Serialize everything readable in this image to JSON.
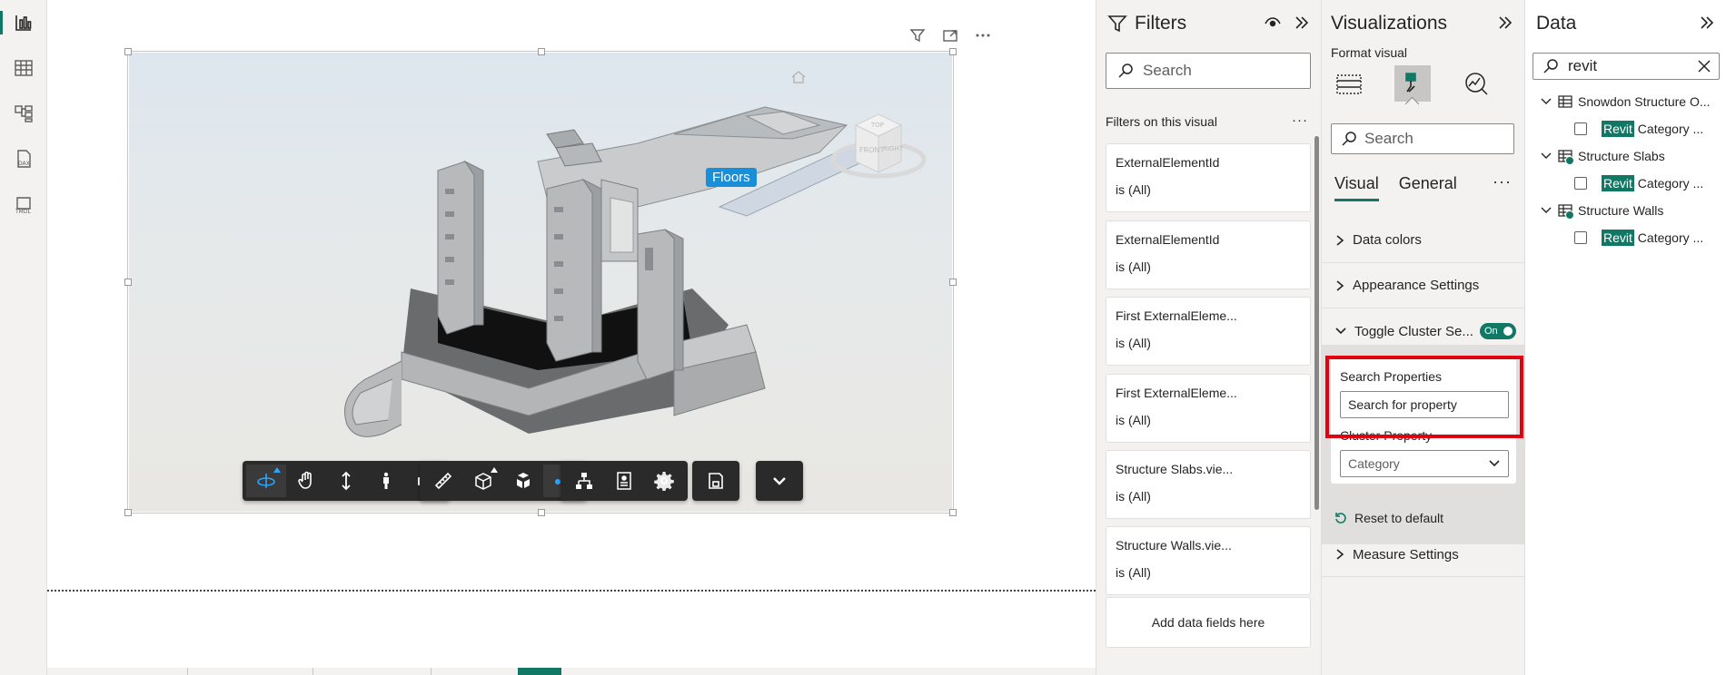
{
  "rail": {
    "items": [
      {
        "name": "report-view",
        "icon": "bar-chart-icon"
      },
      {
        "name": "table-view",
        "icon": "table-icon"
      },
      {
        "name": "model-view",
        "icon": "model-icon"
      },
      {
        "name": "dax-view",
        "icon": "dax-icon",
        "label": "DAX"
      },
      {
        "name": "tmdl-view",
        "icon": "tmdl-icon",
        "label": "TMDL"
      }
    ]
  },
  "visual": {
    "label": "Floors"
  },
  "filters": {
    "title": "Filters",
    "search_placeholder": "Search",
    "section_title": "Filters on this visual",
    "cards": [
      {
        "name": "ExternalElementId",
        "value": "is (All)"
      },
      {
        "name": "ExternalElementId",
        "value": "is (All)"
      },
      {
        "name": "First ExternalEleme...",
        "value": "is (All)"
      },
      {
        "name": "First ExternalEleme...",
        "value": "is (All)"
      },
      {
        "name": "Structure Slabs.vie...",
        "value": "is (All)"
      },
      {
        "name": "Structure Walls.vie...",
        "value": "is (All)"
      }
    ],
    "add_fields": "Add data fields here"
  },
  "viz": {
    "title": "Visualizations",
    "format_label": "Format visual",
    "search_placeholder": "Search",
    "tabs": [
      "Visual",
      "General"
    ],
    "sections": {
      "data_colors": "Data colors",
      "appearance": "Appearance Settings",
      "toggle_cluster": "Toggle Cluster Se...",
      "toggle_state": "On",
      "measure": "Measure Settings"
    },
    "cluster": {
      "search_label": "Search Properties",
      "search_placeholder": "Search for property",
      "cluster_label": "Cluster Property",
      "cluster_value": "Category"
    },
    "reset": "Reset to default"
  },
  "data": {
    "title": "Data",
    "search_value": "revit",
    "tables": [
      {
        "name": "Snowdon Structure O...",
        "child_hl": "Revit",
        "child_rest": " Category ..."
      },
      {
        "name": "Structure Slabs",
        "child_hl": "Revit",
        "child_rest": " Category ..."
      },
      {
        "name": "Structure Walls",
        "child_hl": "Revit",
        "child_rest": " Category ..."
      }
    ]
  },
  "colors": {
    "accent": "#117865",
    "highlight": "#e00010",
    "label_blue": "#1a8fd9"
  }
}
